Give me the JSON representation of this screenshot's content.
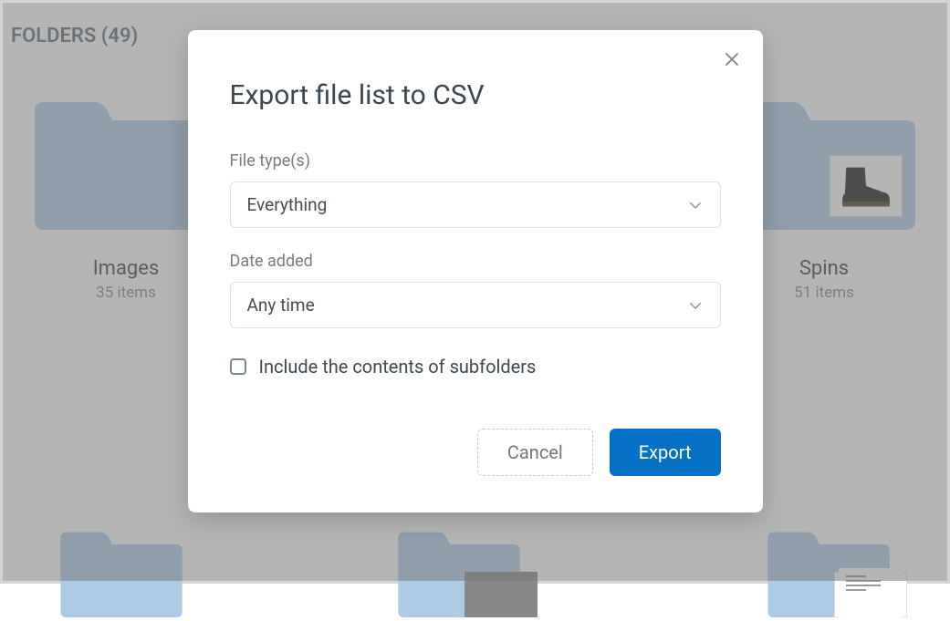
{
  "section": {
    "title": "FOLDERS (49)"
  },
  "folders": [
    {
      "name": "Images",
      "count": "35 items"
    },
    {
      "name": "Spins",
      "count": "51 items"
    }
  ],
  "modal": {
    "title": "Export file list to CSV",
    "file_type_label": "File type(s)",
    "file_type_value": "Everything",
    "date_added_label": "Date added",
    "date_added_value": "Any time",
    "include_subfolders_label": "Include the contents of subfolders",
    "cancel_label": "Cancel",
    "export_label": "Export"
  }
}
